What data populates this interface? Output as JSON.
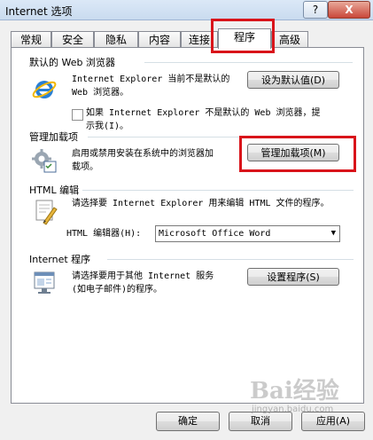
{
  "window": {
    "title": "Internet 选项",
    "help_label": "?",
    "close_label": "X"
  },
  "tabs": [
    {
      "label": "常规"
    },
    {
      "label": "安全"
    },
    {
      "label": "隐私"
    },
    {
      "label": "内容"
    },
    {
      "label": "连接"
    },
    {
      "label": "程序"
    },
    {
      "label": "高级"
    }
  ],
  "default_browser": {
    "title": "默认的 Web 浏览器",
    "desc_line1": "Internet Explorer 当前不是默认的",
    "desc_line2": "Web 浏览器。",
    "set_default_button": "设为默认值(D)",
    "check_line1": "如果 Internet Explorer 不是默认的 Web 浏览器，提",
    "check_line2": "示我(I)。"
  },
  "addons": {
    "title": "管理加载项",
    "desc_line1": "启用或禁用安装在系统中的浏览器加",
    "desc_line2": "载项。",
    "manage_button": "管理加载项(M)"
  },
  "html_editor": {
    "title": "HTML 编辑",
    "desc": "请选择要 Internet Explorer 用来编辑 HTML 文件的程序。",
    "label": "HTML 编辑器(H):",
    "selected": "Microsoft Office Word"
  },
  "internet_programs": {
    "title": "Internet 程序",
    "desc_line1": "请选择要用于其他 Internet 服务",
    "desc_line2": "(如电子邮件)的程序。",
    "set_programs_button": "设置程序(S)"
  },
  "footer": {
    "ok": "确定",
    "cancel": "取消",
    "apply": "应用(A)"
  },
  "watermark": {
    "main": "Bai经验",
    "sub": "jingyan.baidu.com"
  }
}
